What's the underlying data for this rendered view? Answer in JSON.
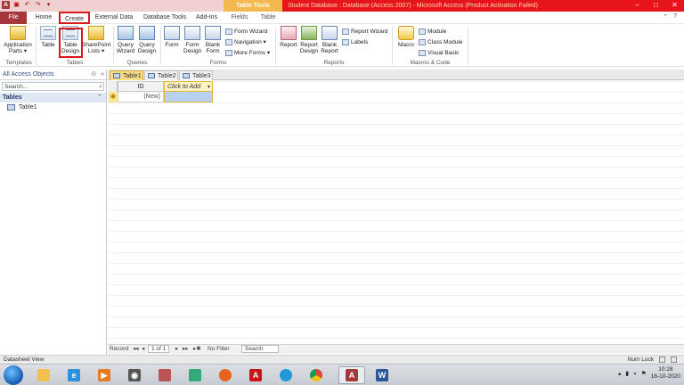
{
  "titlebar": {
    "context_group": "Table Tools",
    "title": "Student Database : Database (Access 2007) - Microsoft Access (Product Activation Failed)",
    "qat_icons": [
      "save-icon",
      "undo-icon",
      "redo-icon",
      "customize-qat-icon"
    ],
    "window_buttons": [
      "–",
      "□",
      "✕"
    ]
  },
  "tabs": {
    "file": "File",
    "home": "Home",
    "create": "Create",
    "external": "External Data",
    "dbtools": "Database Tools",
    "addins": "Add-Ins",
    "fields": "Fields",
    "table": "Table"
  },
  "ribbon": {
    "app_parts_l1": "Application",
    "app_parts_l2": "Parts ▾",
    "table": "Table",
    "table_design_l1": "Table",
    "table_design_l2": "Design",
    "sharepoint_l1": "SharePoint",
    "sharepoint_l2": "Lists ▾",
    "query_wizard_l1": "Query",
    "query_wizard_l2": "Wizard",
    "query_design_l1": "Query",
    "query_design_l2": "Design",
    "form": "Form",
    "form_design_l1": "Form",
    "form_design_l2": "Design",
    "blank_form_l1": "Blank",
    "blank_form_l2": "Form",
    "form_wizard": "Form Wizard",
    "navigation": "Navigation ▾",
    "more_forms": "More Forms ▾",
    "report": "Report",
    "report_design_l1": "Report",
    "report_design_l2": "Design",
    "blank_report_l1": "Blank",
    "blank_report_l2": "Report",
    "report_wizard": "Report Wizard",
    "labels": "Labels",
    "macro": "Macro",
    "module": "Module",
    "class_module": "Class Module",
    "visual_basic": "Visual Basic",
    "groups": {
      "templates": "Templates",
      "tables": "Tables",
      "queries": "Queries",
      "forms": "Forms",
      "reports": "Reports",
      "macros": "Macros & Code"
    }
  },
  "nav": {
    "header": "All Access Objects",
    "search_placeholder": "Search...",
    "group": "Tables",
    "items": [
      {
        "label": "Table1"
      }
    ]
  },
  "doc": {
    "tabs": [
      {
        "label": "Table1"
      },
      {
        "label": "Table2"
      },
      {
        "label": "Table3"
      }
    ],
    "columns": {
      "id": "ID",
      "add": "Click to Add"
    },
    "new_row_marker": "✱",
    "new_row_value": "(New)"
  },
  "recordbar": {
    "label": "Record:",
    "first": "◂◂",
    "prev": "◂",
    "position": "1 of 1",
    "next": "▸",
    "last": "▸▸",
    "new": "▸✱",
    "filter": "No Filter",
    "search": "Search"
  },
  "status": {
    "left": "Datasheet View",
    "num_lock": "Num Lock"
  },
  "taskbar": {
    "time": "10:28",
    "date": "16-10-2020"
  }
}
